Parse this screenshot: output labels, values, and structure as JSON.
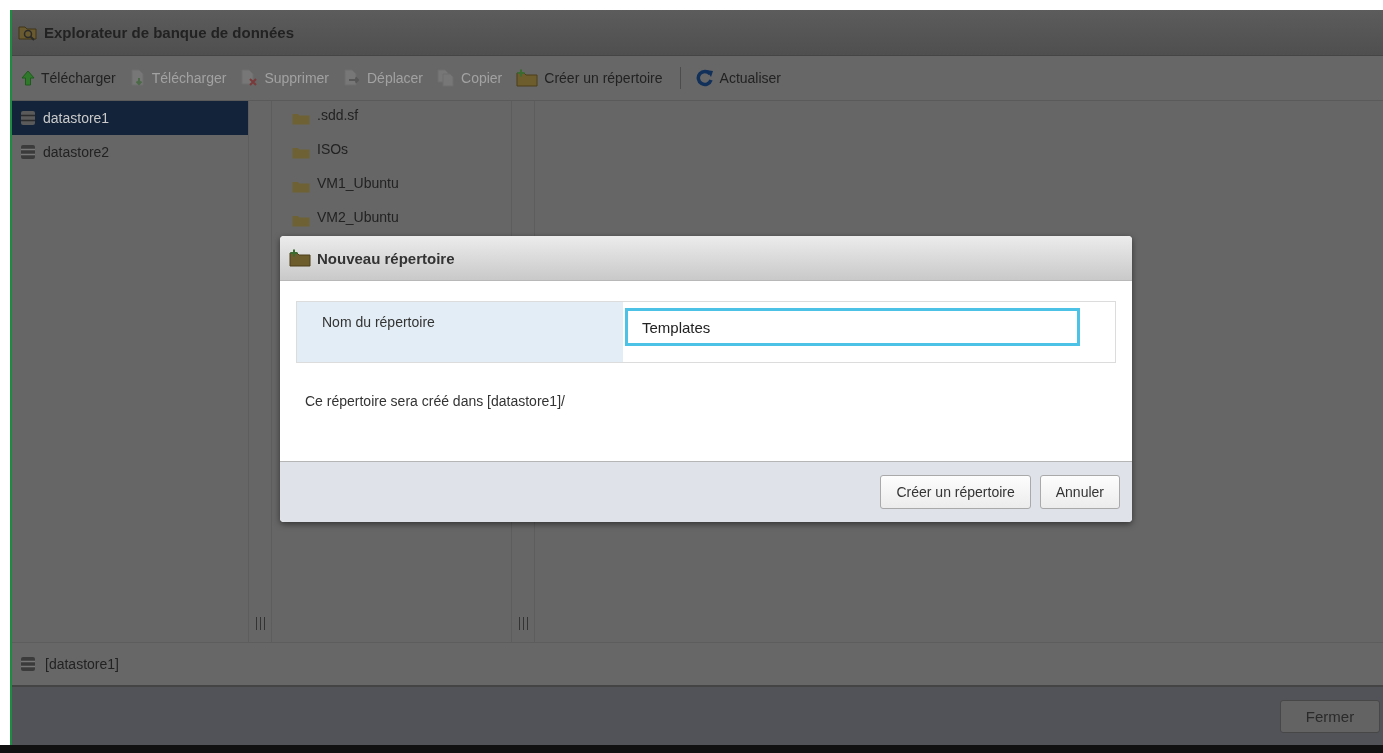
{
  "window": {
    "title": "Explorateur de banque de données"
  },
  "toolbar": {
    "actions": [
      {
        "label": "Télécharger",
        "kind": "upload",
        "disabled": false
      },
      {
        "label": "Télécharger",
        "kind": "download",
        "disabled": true
      },
      {
        "label": "Supprimer",
        "kind": "delete",
        "disabled": true
      },
      {
        "label": "Déplacer",
        "kind": "move",
        "disabled": true
      },
      {
        "label": "Copier",
        "kind": "copy",
        "disabled": true
      },
      {
        "label": "Créer un répertoire",
        "kind": "new-folder",
        "disabled": false
      }
    ],
    "trailing_actions": [
      {
        "label": "Actualiser",
        "kind": "refresh",
        "disabled": false
      }
    ]
  },
  "datastores": [
    {
      "name": "datastore1",
      "selected": true
    },
    {
      "name": "datastore2",
      "selected": false
    }
  ],
  "folders": [
    ".sdd.sf",
    "ISOs",
    "VM1_Ubuntu",
    "VM2_Ubuntu"
  ],
  "path_bar": {
    "path": "[datastore1]"
  },
  "footer": {
    "close_button": "Fermer"
  },
  "dialog": {
    "title": "Nouveau répertoire",
    "field_label": "Nom du répertoire",
    "field_value": "Templates",
    "message": "Ce répertoire sera créé dans [datastore1]/",
    "buttons": [
      "Créer un répertoire",
      "Annuler"
    ]
  }
}
